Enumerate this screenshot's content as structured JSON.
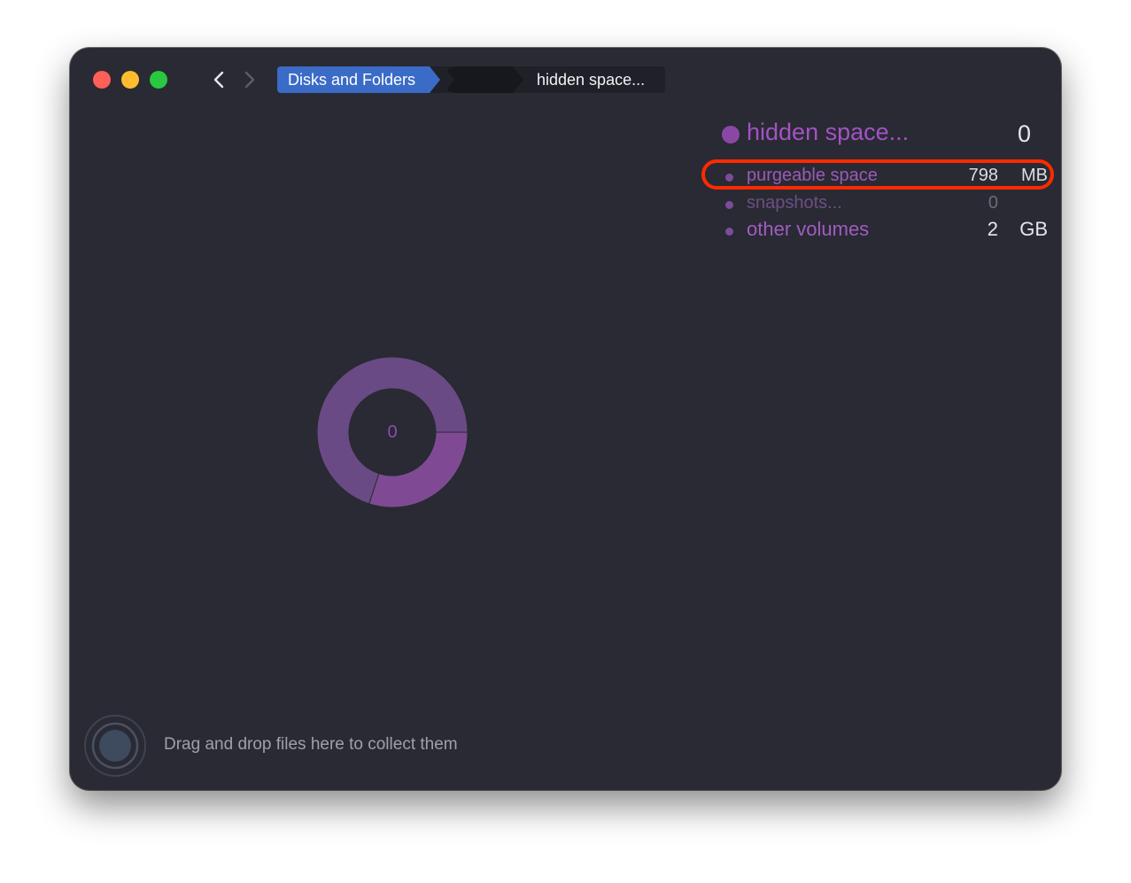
{
  "window": {
    "breadcrumbs": [
      {
        "label": "Disks and Folders",
        "active": true
      },
      {
        "label": "",
        "redacted": true
      },
      {
        "label": "hidden space..."
      }
    ]
  },
  "legend": {
    "title": "hidden space...",
    "title_value": "0",
    "accent_color": "#8b47a6",
    "items": [
      {
        "label": "purgeable space",
        "value": "798",
        "unit": "MB",
        "highlighted": true
      },
      {
        "label": "snapshots...",
        "value": "0",
        "unit": ""
      },
      {
        "label": "other volumes",
        "value": "2",
        "unit": "GB"
      }
    ]
  },
  "donut": {
    "center_label": "0",
    "segments": [
      {
        "name": "other volumes",
        "fraction": 0.7,
        "color": "#6a4a85"
      },
      {
        "name": "purgeable space",
        "fraction": 0.3,
        "color": "#7f4a93"
      }
    ]
  },
  "footer": {
    "drop_hint": "Drag and drop files here to collect them"
  }
}
